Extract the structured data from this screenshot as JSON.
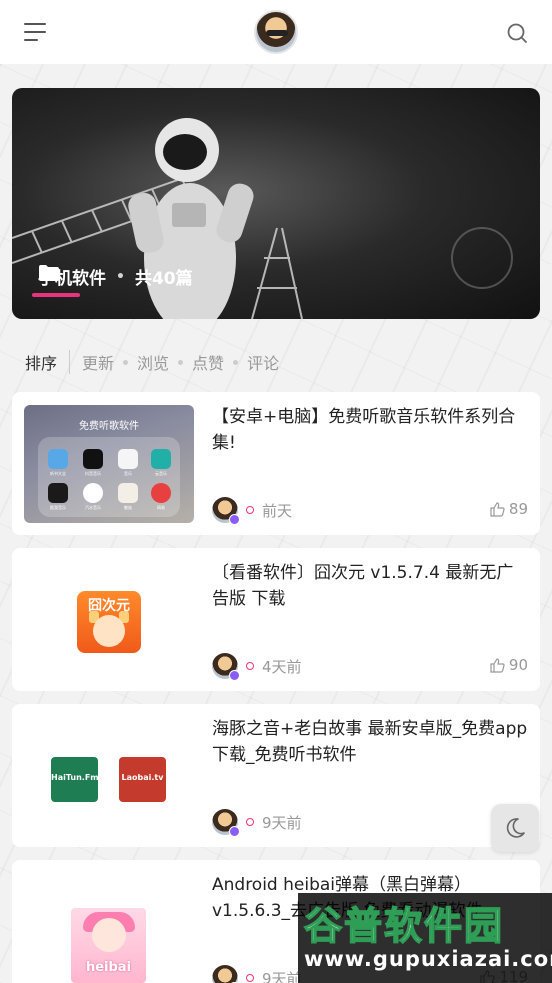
{
  "header": {
    "menu_icon": "menu-icon",
    "avatar_icon": "user-avatar",
    "search_icon": "search-icon"
  },
  "hero": {
    "category": "手机软件",
    "separator": "•",
    "count": "共40篇",
    "accent": "#e8347a"
  },
  "sort": {
    "title": "排序",
    "options": [
      "更新",
      "浏览",
      "点赞",
      "评论"
    ]
  },
  "posts": [
    {
      "title": "【安卓+电脑】免费听歌音乐软件系列合集!",
      "time": "前天",
      "likes": "89",
      "thumb": {
        "heading": "免费听歌软件",
        "apps": [
          "听书大全",
          "抖音音乐",
          "音乐",
          "云音乐",
          "酷我音乐",
          "汽水音乐",
          "魅族",
          "网易"
        ]
      }
    },
    {
      "title": "〔看番软件〕囧次元 v1.5.7.4 最新无广告版 下载",
      "time": "4天前",
      "likes": "90",
      "thumb": {
        "logo_text": "囧次元"
      }
    },
    {
      "title": "海豚之音+老白故事 最新安卓版_免费app下载_免费听书软件",
      "time": "9天前",
      "likes": "",
      "thumb": {
        "logo_left": "HaiTun.Fm",
        "logo_right": "Laobai.tv"
      }
    },
    {
      "title": "Android heibai弹幕（黑白弹幕）v1.5.6.3_去广告版 免费看动漫软件",
      "time": "9天前",
      "likes": "119",
      "thumb": {
        "logo_text": "heibai"
      }
    }
  ],
  "floating": {
    "icon": "moon-icon"
  },
  "watermark": {
    "brand": "谷普软件园",
    "url": "www.gupuxiazai.com"
  }
}
